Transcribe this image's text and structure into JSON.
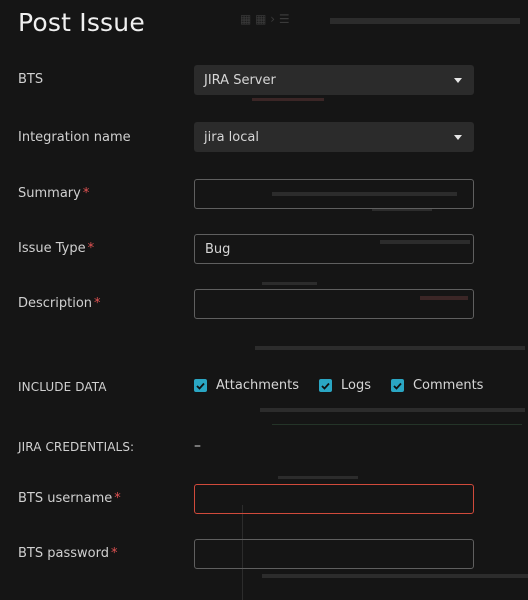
{
  "modal": {
    "title": "Post Issue"
  },
  "form": {
    "bts": {
      "label": "BTS",
      "value": "JIRA Server"
    },
    "integration": {
      "label": "Integration name",
      "value": "jira local"
    },
    "summary": {
      "label": "Summary",
      "required": "*",
      "value": ""
    },
    "issue_type": {
      "label": "Issue Type",
      "required": "*",
      "value": "Bug"
    },
    "description": {
      "label": "Description",
      "required": "*",
      "value": ""
    },
    "include_data": {
      "label": "INCLUDE DATA",
      "options": [
        {
          "label": "Attachments",
          "checked": true
        },
        {
          "label": "Logs",
          "checked": true
        },
        {
          "label": "Comments",
          "checked": true
        }
      ]
    },
    "credentials": {
      "label": "JIRA CREDENTIALS:",
      "value": "–"
    },
    "username": {
      "label": "BTS username",
      "required": "*",
      "value": ""
    },
    "password": {
      "label": "BTS password",
      "required": "*",
      "value": ""
    }
  },
  "colors": {
    "background": "#151515",
    "checkbox": "#2aa6c3",
    "required": "#e35353",
    "error_border": "#d04a3b"
  },
  "icons": [
    "chevron-down-icon",
    "checkmark-icon"
  ]
}
